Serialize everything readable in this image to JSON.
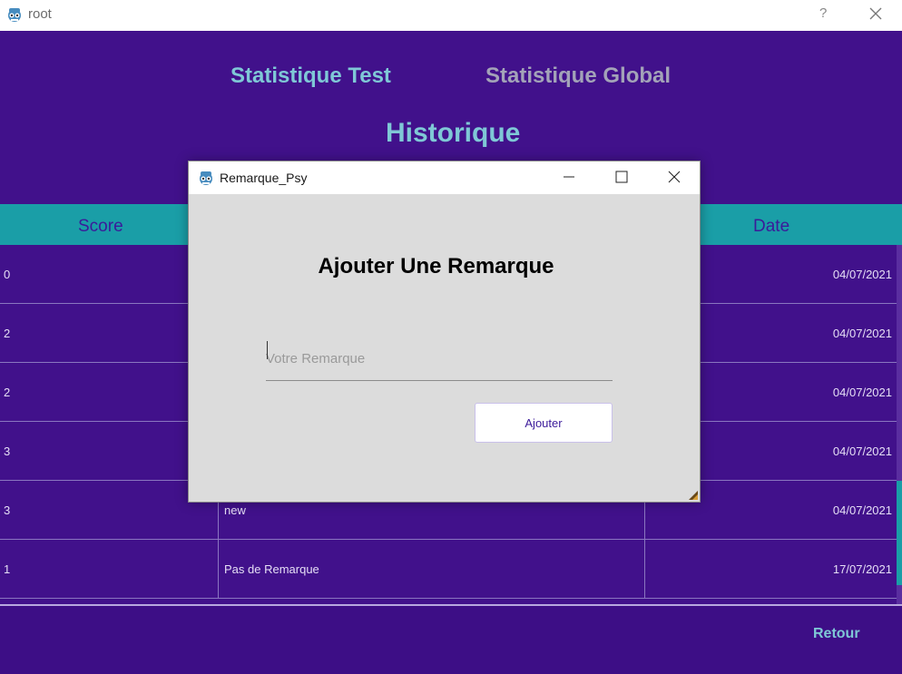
{
  "window": {
    "title": "root",
    "help_label": "?"
  },
  "nav": {
    "test_label": "Statistique Test",
    "global_label": "Statistique Global"
  },
  "page": {
    "title": "Historique"
  },
  "table": {
    "headers": {
      "score": "Score",
      "date": "Date"
    },
    "rows": [
      {
        "score": "0",
        "remark": "",
        "date": "04/07/2021"
      },
      {
        "score": "2",
        "remark": "",
        "date": "04/07/2021"
      },
      {
        "score": "2",
        "remark": "",
        "date": "04/07/2021"
      },
      {
        "score": "3",
        "remark": "",
        "date": "04/07/2021"
      },
      {
        "score": "3",
        "remark": "new",
        "date": "04/07/2021"
      },
      {
        "score": "1",
        "remark": "Pas de Remarque",
        "date": "17/07/2021"
      }
    ]
  },
  "footer": {
    "back_label": "Retour"
  },
  "dialog": {
    "title": "Remarque_Psy",
    "heading": "Ajouter Une Remarque",
    "input_placeholder": "Votre Remarque",
    "input_value": "",
    "submit_label": "Ajouter"
  },
  "colors": {
    "background": "#41118b",
    "accent": "#7fc8d6",
    "header_bar": "#1a9ea7",
    "dialog_bg": "#dcdcdc"
  }
}
